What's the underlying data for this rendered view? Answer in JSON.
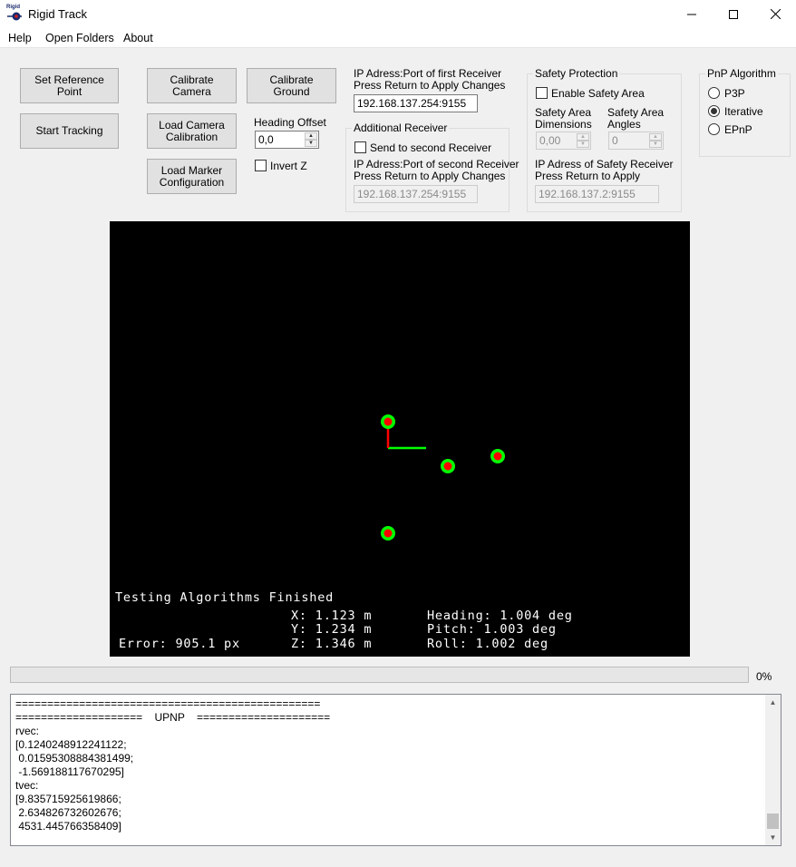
{
  "window": {
    "title": "Rigid Track",
    "icon_text": "Rigid"
  },
  "menu": [
    "Help",
    "Open Folders",
    "About"
  ],
  "buttons": {
    "set_reference": "Set Reference Point",
    "start_tracking": "Start Tracking",
    "calibrate_camera": "Calibrate\nCamera",
    "calibrate_ground": "Calibrate\nGround",
    "load_camera_calibration": "Load Camera\nCalibration",
    "load_marker_configuration": "Load Marker\nConfiguration"
  },
  "heading": {
    "label": "Heading Offset",
    "value": "0,0",
    "invert_z": "Invert Z"
  },
  "receiver": {
    "first_label": "IP Adress:Port of first Receiver\n Press Return to Apply Changes",
    "first_value": "192.168.137.254:9155",
    "additional_title": "Additional Receiver",
    "send_second": "Send to second Receiver",
    "second_label": "IP Adress:Port of second Receiver\n Press Return to Apply Changes",
    "second_value": "192.168.137.254:9155"
  },
  "safety": {
    "title": "Safety Protection",
    "enable": "Enable Safety Area",
    "dimensions_label": "Safety Area\nDimensions",
    "angles_label": "Safety Area\nAngles",
    "dimensions_value": "0,00",
    "angles_value": "0",
    "receiver_label": "IP Adress of Safety Receiver\nPress Return to Apply",
    "receiver_value": "192.168.137.2:9155"
  },
  "pnp": {
    "title": "PnP Algorithm",
    "options": [
      "P3P",
      "Iterative",
      "EPnP"
    ],
    "selected": "Iterative"
  },
  "video": {
    "status": "Testing Algorithms Finished",
    "x": "X: 1.123 m",
    "y": "Y: 1.234 m",
    "z": "Z: 1.346 m",
    "heading": "Heading: 1.004 deg",
    "pitch": "Pitch: 1.003 deg",
    "roll": "Roll: 1.002 deg",
    "error": "Error: 905.1 px",
    "colors": {
      "marker_outer": "#00ff00",
      "marker_inner": "#ff0000",
      "axis_x": "#00ff00",
      "axis_y": "#ff0000"
    }
  },
  "progress": {
    "value": 0,
    "label": "0%"
  },
  "log": {
    "lines": [
      "================================================",
      "====================    UPNP    =====================",
      "rvec:",
      "[0.1240248912241122;",
      " 0.01595308884381499;",
      " -1.569188117670295]",
      "tvec:",
      "[9.835715925619866;",
      " 2.634826732602676;",
      " 4531.445766358409]"
    ]
  }
}
